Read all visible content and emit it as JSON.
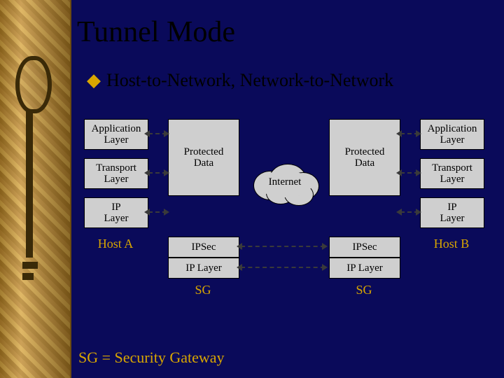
{
  "title": "Tunnel Mode",
  "subtitle": "Host-to-Network, Network-to-Network",
  "hostA": {
    "app": "Application\nLayer",
    "transport": "Transport\nLayer",
    "ip": "IP\nLayer",
    "label": "Host A"
  },
  "hostB": {
    "app": "Application\nLayer",
    "transport": "Transport\nLayer",
    "ip": "IP\nLayer",
    "label": "Host B"
  },
  "sg1": {
    "protected": "Protected\nData",
    "ipsec": "IPSec",
    "iplayer": "IP Layer",
    "label": "SG"
  },
  "sg2": {
    "protected": "Protected\nData",
    "ipsec": "IPSec",
    "iplayer": "IP Layer",
    "label": "SG"
  },
  "internet": "Internet",
  "legend": "SG = Security Gateway",
  "colors": {
    "accent": "#d9a600",
    "bg": "#0a0a5a",
    "box": "#cfcfcf"
  }
}
